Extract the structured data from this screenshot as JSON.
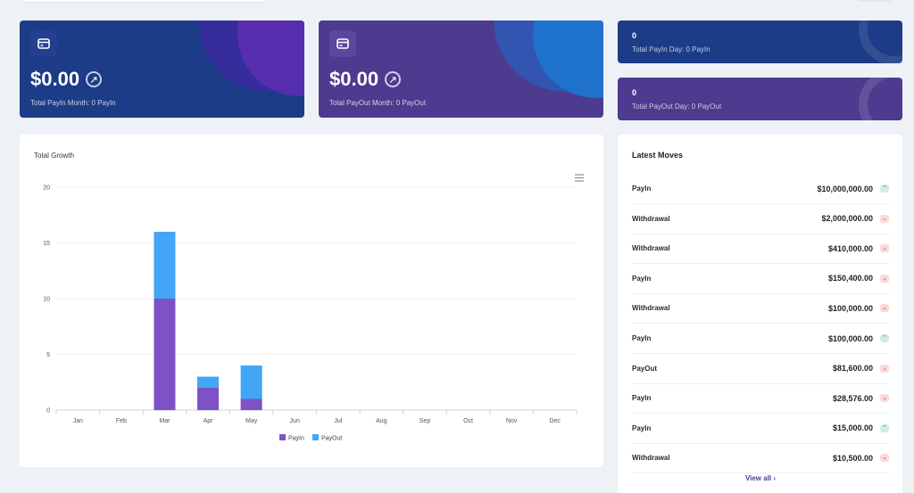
{
  "stats": {
    "payin_month": {
      "amount": "$0.00",
      "label": "Total PayIn Month: 0 PayIn",
      "arrow": "arrow-up-right-icon"
    },
    "payout_month": {
      "amount": "$0.00",
      "label": "Total PayOut Month: 0 PayOut",
      "arrow": "arrow-up-right-icon"
    },
    "payin_day": {
      "value": "0",
      "label": "Total PayIn Day: 0 PayIn"
    },
    "payout_day": {
      "value": "0",
      "label": "Total PayOut Day: 0 PayOut"
    }
  },
  "colors": {
    "blue_card": "#1c3c87",
    "purple_card": "#4d3b8f",
    "payin": "#7e52c6",
    "payout": "#42a5f5"
  },
  "growth": {
    "title": "Total Growth",
    "menu_icon": "hamburger-menu-icon"
  },
  "chart_data": {
    "type": "bar",
    "stacked": true,
    "title": "Total Growth",
    "categories": [
      "Jan",
      "Feb",
      "Mar",
      "Apr",
      "May",
      "Jun",
      "Jul",
      "Aug",
      "Sep",
      "Oct",
      "Nov",
      "Dec"
    ],
    "series": [
      {
        "name": "PayIn",
        "values": [
          0,
          0,
          10,
          2,
          1,
          0,
          0,
          0,
          0,
          0,
          0,
          0
        ]
      },
      {
        "name": "PayOut",
        "values": [
          0,
          0,
          6,
          1,
          3,
          0,
          0,
          0,
          0,
          0,
          0,
          0
        ]
      }
    ],
    "ylim": [
      0,
      20
    ],
    "yticks": [
      0,
      5,
      10,
      15,
      20
    ],
    "grid": true,
    "legend": "bottom"
  },
  "moves": {
    "title": "Latest Moves",
    "items": [
      {
        "label": "PayIn",
        "amount": "$10,000,000.00",
        "direction": "up"
      },
      {
        "label": "Withdrawal",
        "amount": "$2,000,000.00",
        "direction": "down"
      },
      {
        "label": "Withdrawal",
        "amount": "$410,000.00",
        "direction": "down"
      },
      {
        "label": "PayIn",
        "amount": "$150,400.00",
        "direction": "down"
      },
      {
        "label": "Withdrawal",
        "amount": "$100,000.00",
        "direction": "down"
      },
      {
        "label": "PayIn",
        "amount": "$100,000.00",
        "direction": "up"
      },
      {
        "label": "PayOut",
        "amount": "$81,600.00",
        "direction": "down"
      },
      {
        "label": "PayIn",
        "amount": "$28,576.00",
        "direction": "down"
      },
      {
        "label": "PayIn",
        "amount": "$15,000.00",
        "direction": "up"
      },
      {
        "label": "Withdrawal",
        "amount": "$10,500.00",
        "direction": "down"
      }
    ],
    "view_all": "View all"
  }
}
